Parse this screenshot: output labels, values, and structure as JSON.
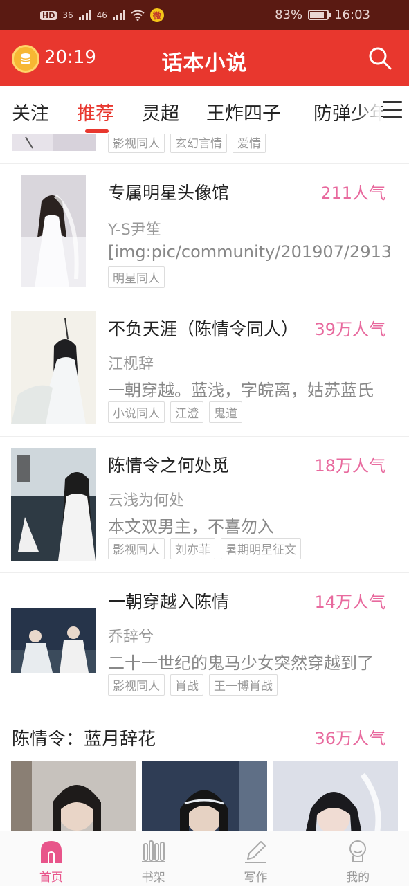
{
  "status_bar": {
    "hd_badge": "HD",
    "signal1": "36",
    "signal2": "46",
    "battery_percent": "83%",
    "clock": "16:03",
    "battery_level": 0.83
  },
  "app_bar": {
    "timer": "20:19",
    "title": "话本小说",
    "accent_color": "#e8372e"
  },
  "tabs": {
    "items": [
      "关注",
      "推荐",
      "灵超",
      "王炸四子",
      "防弹少年团"
    ],
    "active_index": 1
  },
  "feed": {
    "partial_card": {
      "tags": [
        "影视同人",
        "玄幻言情",
        "爱情"
      ]
    },
    "cards": [
      {
        "title": "专属明星头像馆",
        "popularity": "211人气",
        "author": "Y-S尹笙",
        "description": "[img:pic/community/201907/2913",
        "tags": [
          "明星同人"
        ]
      },
      {
        "title": "不负天涯（陈情令同人）",
        "popularity": "39万人气",
        "author": "江枧辞",
        "description": "一朝穿越。蓝浅，字皖离，姑苏蓝氏",
        "tags": [
          "小说同人",
          "江澄",
          "鬼道"
        ]
      },
      {
        "title": "陈情令之何处觅",
        "popularity": "18万人气",
        "author": "云浅为何处",
        "description": "本文双男主，不喜勿入",
        "tags": [
          "影视同人",
          "刘亦菲",
          "暑期明星征文"
        ]
      },
      {
        "title": "一朝穿越入陈情",
        "popularity": "14万人气",
        "author": "乔辞兮",
        "description": "二十一世纪的鬼马少女突然穿越到了",
        "tags": [
          "影视同人",
          "肖战",
          "王一博肖战"
        ]
      }
    ],
    "featured": {
      "title": "陈情令：蓝月辞花",
      "popularity": "36万人气"
    }
  },
  "bottom_nav": {
    "items": [
      "首页",
      "书架",
      "写作",
      "我的"
    ],
    "active_index": 0,
    "active_color": "#e8548a"
  }
}
